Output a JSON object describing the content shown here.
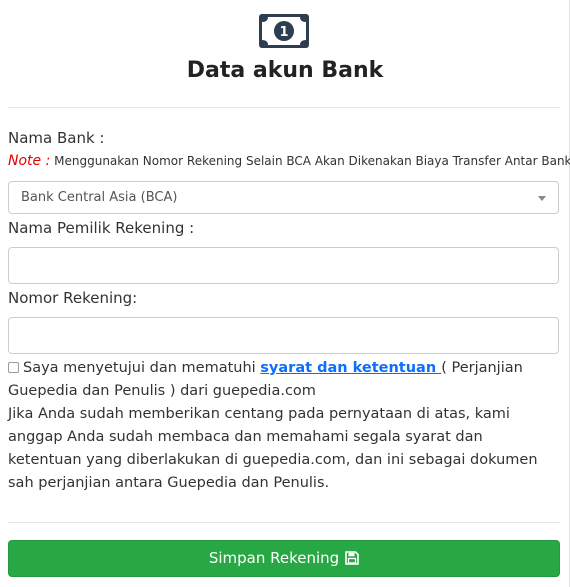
{
  "header": {
    "icon": "money-bill-icon",
    "title": "Data akun Bank"
  },
  "bank": {
    "label": "Nama Bank :",
    "note_label": "Note :",
    "note_text": "Menggunakan Nomor Rekening Selain BCA Akan Dikenakan Biaya Transfer Antar Bank",
    "selected": "Bank Central Asia (BCA)"
  },
  "owner": {
    "label": "Nama Pemilik Rekening :",
    "value": ""
  },
  "account": {
    "label": "Nomor Rekening:",
    "value": ""
  },
  "agreement": {
    "checked": false,
    "text_before": "Saya menyetujui dan mematuhi ",
    "link_text": "syarat dan ketentuan ",
    "text_after": "( Perjanjian Guepedia dan Penulis ) dari guepedia.com",
    "description": "Jika Anda sudah memberikan centang pada pernyataan di atas, kami anggap Anda sudah membaca dan memahami segala syarat dan ketentuan yang diberlakukan di guepedia.com, dan ini sebagai dokumen sah perjanjian antara Guepedia dan Penulis."
  },
  "actions": {
    "save_label": "Simpan Rekening",
    "save_icon": "floppy-disk-icon"
  },
  "colors": {
    "accent": "#28a745",
    "link": "#0d6efd",
    "note": "#e60000"
  }
}
